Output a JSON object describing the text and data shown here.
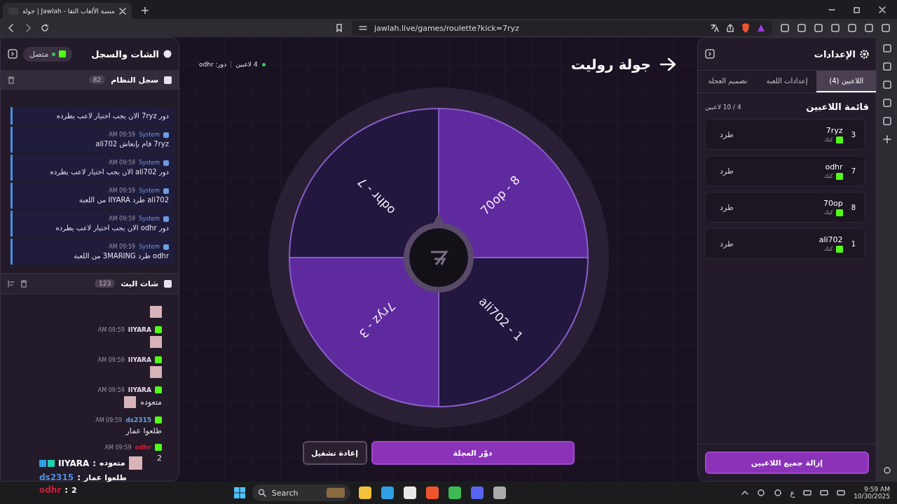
{
  "browser": {
    "tab_title": "جولة | Jawlah - منصة الألعاب التفا",
    "url": "jawlah.live/games/roulette?kick=7ryz"
  },
  "chat_panel": {
    "title": "الشات والسجل",
    "status": "متصل",
    "connected": true,
    "system_log": {
      "title": "سجل النظام",
      "count": "82",
      "entries": [
        {
          "text": "دور 7ryz الان يجب اختيار لاعب يطرده"
        },
        {
          "sender": "System",
          "time": "AM 09:59",
          "text": "7ryz قام بإنعاش ali702"
        },
        {
          "sender": "System",
          "time": "AM 09:59",
          "text": "دور ali702 الان يجب اختيار لاعب يطرده"
        },
        {
          "sender": "System",
          "time": "AM 09:59",
          "text": "ali702 طرد IIYARA من اللعبة"
        },
        {
          "sender": "System",
          "time": "AM 09:59",
          "text": "دور odhr الان يجب اختيار لاعب يطرده"
        },
        {
          "sender": "System",
          "time": "AM 09:59",
          "text": "odhr طرد 3MARING من اللعبة"
        }
      ]
    },
    "stream_chat": {
      "title": "شات البث",
      "count": "123",
      "messages": [
        {
          "emote": true
        },
        {
          "user": "IIYARA",
          "color": "#e6d8f0",
          "time": "AM 09:59",
          "emote": true
        },
        {
          "user": "IIYARA",
          "color": "#e6d8f0",
          "time": "AM 09:59",
          "emote": true
        },
        {
          "user": "IIYARA",
          "color": "#e6d8f0",
          "time": "AM 09:59",
          "text": "متعوده",
          "emote": true
        },
        {
          "user": "ds2315",
          "color": "#6a9de0",
          "time": "AM 09:59",
          "text": "طلعوا عمار",
          "emote": false
        },
        {
          "user": "odhr",
          "color": "#c8203c",
          "time": "AM 09:59",
          "text": "2",
          "emote": false
        }
      ]
    }
  },
  "game": {
    "title": "جولة روليت",
    "players_count": "4 لاعبين",
    "turn": "دور: odhr",
    "wheel": {
      "segments": [
        {
          "label": "70op - 8",
          "color": "#5f2a9e"
        },
        {
          "label": "ali702 - 1",
          "color": "#21173f"
        },
        {
          "label": "7ryz - 3",
          "color": "#5f2a9e"
        },
        {
          "label": "odhr - 7",
          "color": "#21173f"
        }
      ]
    },
    "buttons": [
      {
        "label": "دوّر العجلة",
        "kind": "primary"
      },
      {
        "label": "إعادة تشغيل",
        "kind": "secondary"
      }
    ]
  },
  "settings": {
    "title": "الإعدادات",
    "tabs": [
      {
        "label": "اللاعبين (4)",
        "selected": true
      },
      {
        "label": "إعدادات اللعبة",
        "selected": false
      },
      {
        "label": "تصميم العجلة",
        "selected": false
      }
    ],
    "list_title": "قائمة اللاعبين",
    "list_count": "4 / 10 لاعبين",
    "players": [
      {
        "number": "3",
        "name": "7ryz",
        "platform": "كيك",
        "action": "طرد"
      },
      {
        "number": "7",
        "name": "odhr",
        "platform": "كيك",
        "action": "طرد"
      },
      {
        "number": "8",
        "name": "70op",
        "platform": "كيك",
        "action": "طرد"
      },
      {
        "number": "1",
        "name": "ali702",
        "platform": "كيك",
        "action": "طرد"
      }
    ],
    "remove_all": "إزالة جميع اللاعبين"
  },
  "overlay": [
    {
      "user": "IIYARA",
      "separator": ":",
      "color": "#ffffff",
      "text": "متعوده",
      "emote": true,
      "badges": true
    },
    {
      "user": "ds2315",
      "separator": ":",
      "color": "#4f8fe0",
      "text": "طلعوا عمار",
      "emote": false,
      "badges": false
    },
    {
      "user": "odhr",
      "separator": ":",
      "color": "#c8203c",
      "text": "2",
      "emote": false,
      "badges": false
    }
  ],
  "taskbar": {
    "search": "Search",
    "lang": "ع",
    "time": "9:59 AM",
    "date": "10/30/2025"
  }
}
